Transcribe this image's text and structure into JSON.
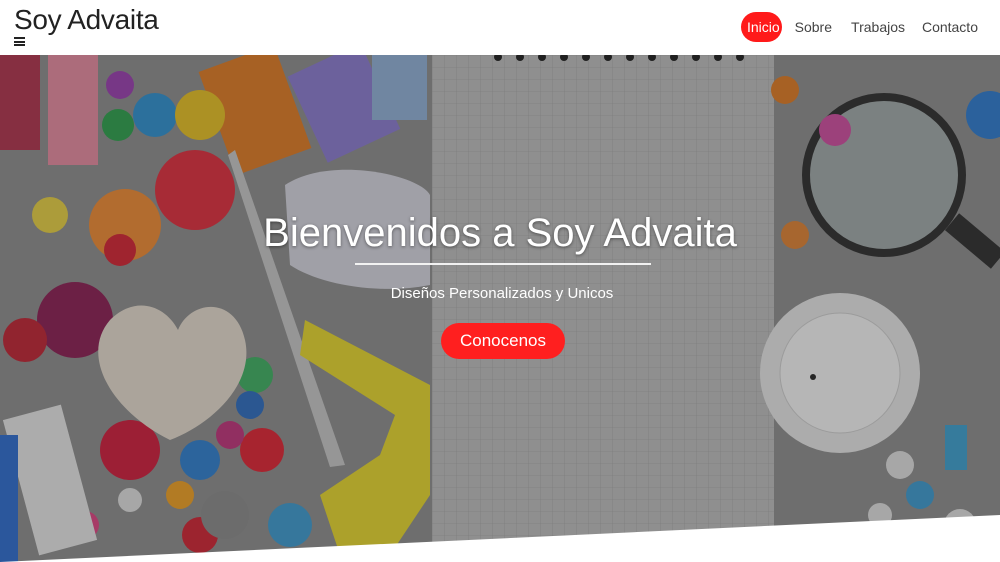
{
  "header": {
    "brand": "Soy Advaita",
    "menu_icon": "hamburger-icon"
  },
  "nav": {
    "items": [
      {
        "label": "Inicio",
        "active": true
      },
      {
        "label": "Sobre",
        "active": false
      },
      {
        "label": "Trabajos",
        "active": false
      },
      {
        "label": "Contacto",
        "active": false
      }
    ]
  },
  "hero": {
    "title": "Bienvenidos a Soy Advaita",
    "subtitle": "Diseños Personalizados y Unicos",
    "cta_label": "Conocenos"
  },
  "colors": {
    "accent": "#ff1a1a",
    "overlay": "#3a3a3a"
  }
}
